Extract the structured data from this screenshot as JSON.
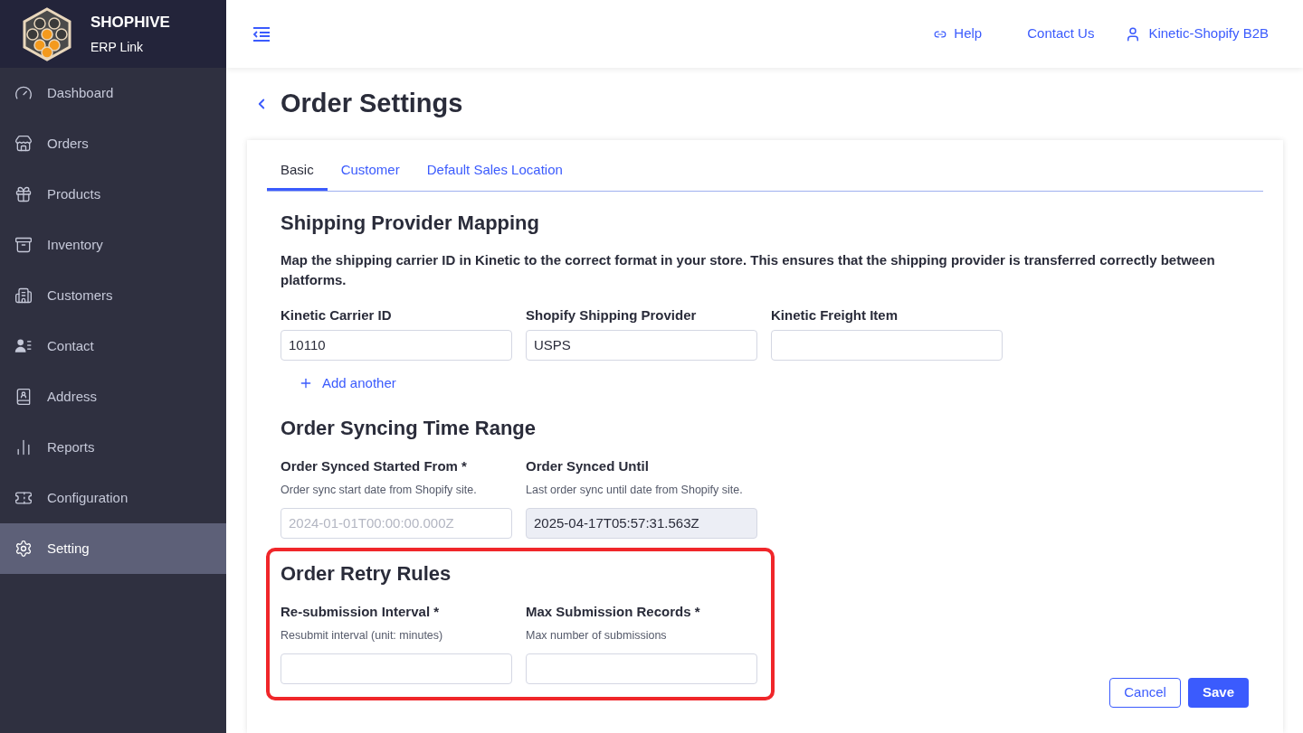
{
  "brand": {
    "name": "SHOPHIVE",
    "subtitle": "ERP Link"
  },
  "sidebar": {
    "items": [
      {
        "label": "Dashboard",
        "selected": false
      },
      {
        "label": "Orders",
        "selected": false
      },
      {
        "label": "Products",
        "selected": false
      },
      {
        "label": "Inventory",
        "selected": false
      },
      {
        "label": "Customers",
        "selected": false
      },
      {
        "label": "Contact",
        "selected": false
      },
      {
        "label": "Address",
        "selected": false
      },
      {
        "label": "Reports",
        "selected": false
      },
      {
        "label": "Configuration",
        "selected": false
      },
      {
        "label": "Setting",
        "selected": true
      }
    ]
  },
  "header": {
    "links": [
      "Help",
      "Contact Us"
    ],
    "user": "Kinetic-Shopify B2B"
  },
  "page": {
    "title": "Order Settings"
  },
  "tabs": [
    {
      "label": "Basic",
      "selected": true
    },
    {
      "label": "Customer",
      "selected": false
    },
    {
      "label": "Default Sales Location",
      "selected": false
    }
  ],
  "sections": [
    {
      "title": "Shipping Provider Mapping",
      "highlighted": false,
      "description": "Map the shipping carrier ID in Kinetic to the correct format in your store. This ensures that the shipping provider is transferred correctly between platforms.",
      "fields": [
        {
          "label": "Kinetic Carrier ID",
          "value": "10110",
          "disabled": false
        },
        {
          "label": "Shopify Shipping Provider",
          "value": "USPS",
          "disabled": false
        },
        {
          "label": "Kinetic Freight Item",
          "disabled": false
        }
      ],
      "add_link": "Add another"
    },
    {
      "title": "Order Syncing Time Range",
      "highlighted": false,
      "fields": [
        {
          "label": "Order Synced Started From *",
          "hint": "Order sync start date from Shopify site.",
          "placeholder": "2024-01-01T00:00:00.000Z",
          "disabled": false
        },
        {
          "label": "Order Synced Until",
          "hint": "Last order sync until date from Shopify site.",
          "value": "2025-04-17T05:57:31.563Z",
          "disabled": true
        }
      ]
    },
    {
      "title": "Order Retry Rules",
      "highlighted": true,
      "fields": [
        {
          "label": "Re-submission Interval *",
          "hint": "Resubmit interval (unit: minutes)",
          "disabled": false
        },
        {
          "label": "Max Submission Records *",
          "hint": "Max number of submissions",
          "disabled": false
        }
      ]
    }
  ],
  "buttons": {
    "cancel": "Cancel",
    "save": "Save"
  }
}
